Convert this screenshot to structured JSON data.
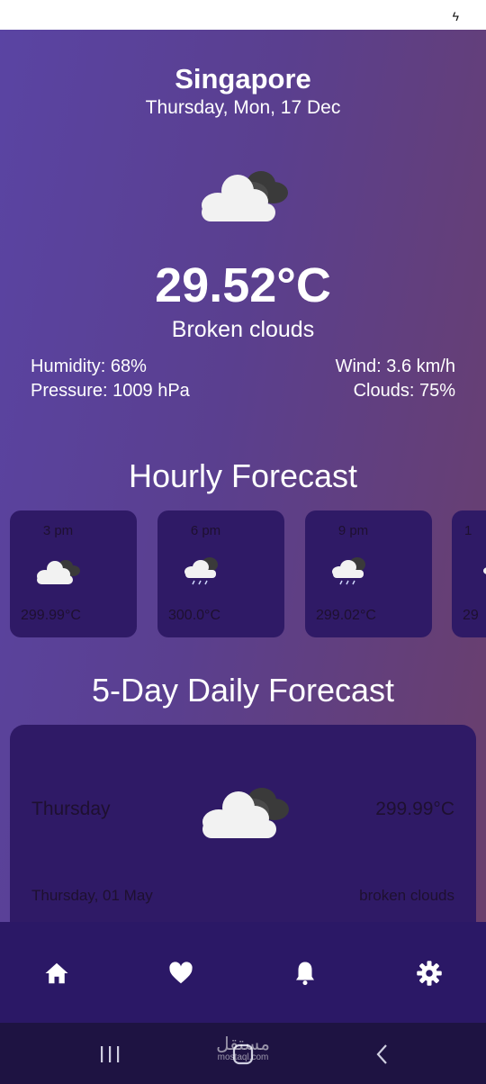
{
  "status_bar": {
    "charging_icon": "bolt-icon"
  },
  "current": {
    "city": "Singapore",
    "date": "Thursday, Mon, 17 Dec",
    "icon": "broken-clouds-icon",
    "temperature": "29.52°C",
    "description": "Broken clouds",
    "humidity": "Humidity: 68%",
    "wind": "Wind: 3.6 km/h",
    "pressure": "Pressure: 1009 hPa",
    "clouds": "Clouds: 75%"
  },
  "hourly": {
    "title": "Hourly Forecast",
    "items": [
      {
        "time": "3 pm",
        "temp": "299.99°C",
        "icon": "broken-clouds-icon"
      },
      {
        "time": "6 pm",
        "temp": "300.0°C",
        "icon": "rain-cloud-icon"
      },
      {
        "time": "9 pm",
        "temp": "299.02°C",
        "icon": "rain-cloud-icon"
      },
      {
        "time": "1",
        "temp": "29",
        "icon": "cloud-icon"
      }
    ]
  },
  "daily": {
    "title": "5-Day Daily Forecast",
    "items": [
      {
        "day": "Thursday",
        "temp": "299.99°C",
        "date": "Thursday, 01 May",
        "description": "broken clouds",
        "icon": "broken-clouds-icon"
      }
    ]
  },
  "bottom_nav": {
    "items": [
      {
        "name": "home",
        "icon": "home-icon"
      },
      {
        "name": "favorites",
        "icon": "heart-icon"
      },
      {
        "name": "notifications",
        "icon": "bell-icon"
      },
      {
        "name": "settings",
        "icon": "gear-icon"
      }
    ]
  },
  "system_nav": {
    "recents_icon": "recents-icon",
    "home_icon": "home-square-icon",
    "back_icon": "back-chevron-icon"
  },
  "watermark": {
    "text": "مستقل",
    "sub": "mostaql.com"
  },
  "colors": {
    "accent": "#2f1a66",
    "nav_bar": "#2b1866",
    "system_nav": "#1e1342",
    "text_dim": "#1e1030"
  }
}
